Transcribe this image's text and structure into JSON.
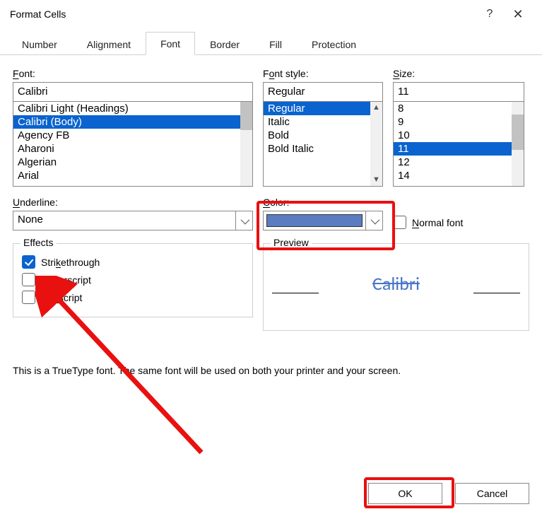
{
  "title": "Format Cells",
  "tabs": [
    "Number",
    "Alignment",
    "Font",
    "Border",
    "Fill",
    "Protection"
  ],
  "activeTab": "Font",
  "font": {
    "label_html": "<span class='u'>F</span>ont:",
    "value": "Calibri",
    "items": [
      "Calibri Light (Headings)",
      "Calibri (Body)",
      "Agency FB",
      "Aharoni",
      "Algerian",
      "Arial"
    ],
    "selectedIndex": 1
  },
  "style": {
    "label_html": "F<span class='u'>o</span>nt style:",
    "value": "Regular",
    "items": [
      "Regular",
      "Italic",
      "Bold",
      "Bold Italic"
    ],
    "selectedIndex": 0
  },
  "size": {
    "label_html": "<span class='u'>S</span>ize:",
    "value": "11",
    "items": [
      "8",
      "9",
      "10",
      "11",
      "12",
      "14"
    ],
    "selectedIndex": 3
  },
  "underline": {
    "label_html": "<span class='u'>U</span>nderline:",
    "value": "None"
  },
  "color": {
    "label_html": "<span class='u'>C</span>olor:",
    "swatch": "#5a7cc0"
  },
  "normalFont": {
    "label_html": "<span class='u'>N</span>ormal font",
    "checked": false
  },
  "effects": {
    "legend": "Effects",
    "items": [
      {
        "label_html": "Stri<span class='u'>k</span>ethrough",
        "checked": true,
        "name": "strikethrough"
      },
      {
        "label_html": "Sup<span class='u'>e</span>rscript",
        "checked": false,
        "name": "superscript"
      },
      {
        "label_html": "Su<span class='u'>b</span>script",
        "checked": false,
        "name": "subscript"
      }
    ]
  },
  "preview": {
    "legend": "Preview",
    "text": "Calibri"
  },
  "hint": "This is a TrueType font.  The same font will be used on both your printer and your screen.",
  "buttons": {
    "ok": "OK",
    "cancel": "Cancel"
  }
}
